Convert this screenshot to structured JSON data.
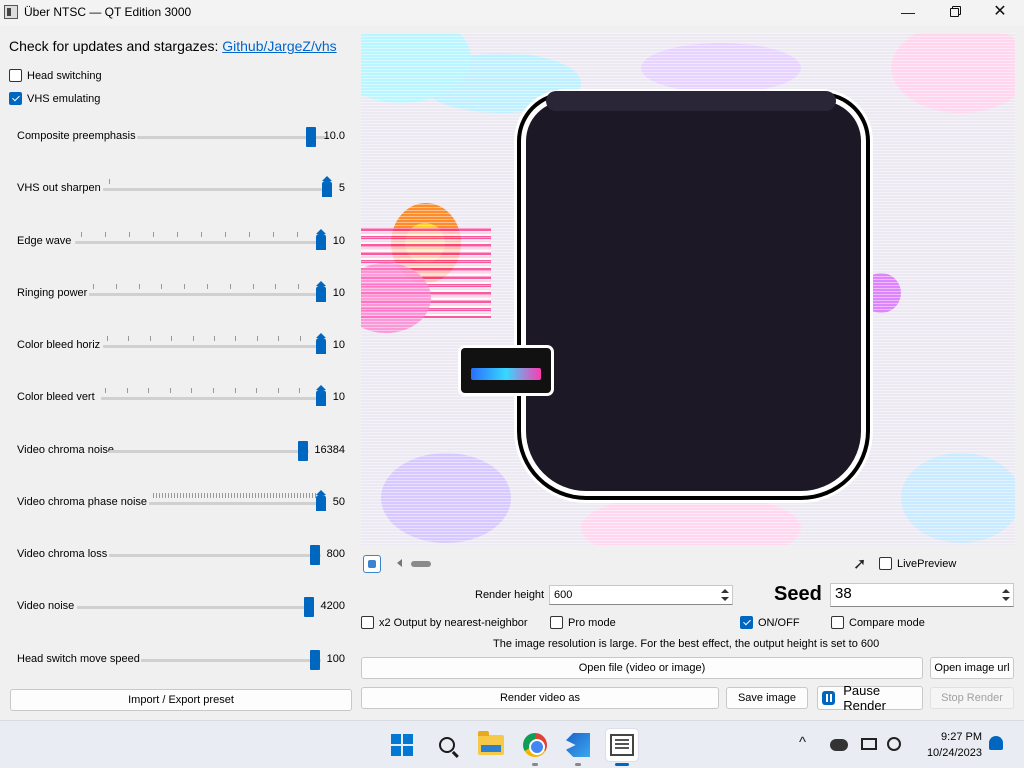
{
  "window": {
    "title": "Über NTSC — QT Edition 3000",
    "minimize": "—",
    "close": "✕"
  },
  "header": {
    "text": "Check for updates and stargazes: ",
    "link": "Github/JargeZ/vhs"
  },
  "checks": {
    "head_switching": {
      "label": "Head switching",
      "checked": false
    },
    "vhs_emulating": {
      "label": "VHS emulating",
      "checked": true
    }
  },
  "sliders": [
    {
      "label": "Composite preemphasis",
      "value": "10.0",
      "position": 1.0
    },
    {
      "label": "VHS out sharpen",
      "value": "5",
      "position": 1.0
    },
    {
      "label": "Edge wave",
      "value": "10",
      "position": 1.0
    },
    {
      "label": "Ringing power",
      "value": "10",
      "position": 1.0
    },
    {
      "label": "Color bleed horiz",
      "value": "10",
      "position": 1.0
    },
    {
      "label": "Color bleed vert",
      "value": "10",
      "position": 1.0
    },
    {
      "label": "Video chroma noise",
      "value": "16384",
      "position": 1.0
    },
    {
      "label": "Video chroma phase noise",
      "value": "50",
      "position": 1.0
    },
    {
      "label": "Video chroma loss",
      "value": "800",
      "position": 1.0
    },
    {
      "label": "Video noise",
      "value": "4200",
      "position": 1.0
    },
    {
      "label": "Head switch move speed",
      "value": "100",
      "position": 1.0
    }
  ],
  "left_buttons": {
    "import_export": "Import / Export preset"
  },
  "preview": {
    "live_preview_label": "LivePreview",
    "live_preview_checked": false
  },
  "controls": {
    "render_height_label": "Render height",
    "render_height_value": "600",
    "seed_label": "Seed",
    "seed_value": "38",
    "x2_output_label": "x2 Output by nearest-neighbor",
    "x2_output_checked": false,
    "pro_mode_label": "Pro mode",
    "pro_mode_checked": false,
    "on_off_label": "ON/OFF",
    "on_off_checked": true,
    "compare_mode_label": "Compare mode",
    "compare_mode_checked": false,
    "info_text": "The image resolution is large. For the best effect, the output height is set to 600",
    "open_file": "Open file (video or image)",
    "open_image_url": "Open image url",
    "render_video_as": "Render video as",
    "save_image": "Save image",
    "pause_render": "Pause Render",
    "stop_render": "Stop Render"
  },
  "taskbar": {
    "time": "9:27 PM",
    "date": "10/24/2023",
    "tray_chevron": "^"
  },
  "colors": {
    "accent": "#0067c0",
    "link": "#0066cc"
  }
}
